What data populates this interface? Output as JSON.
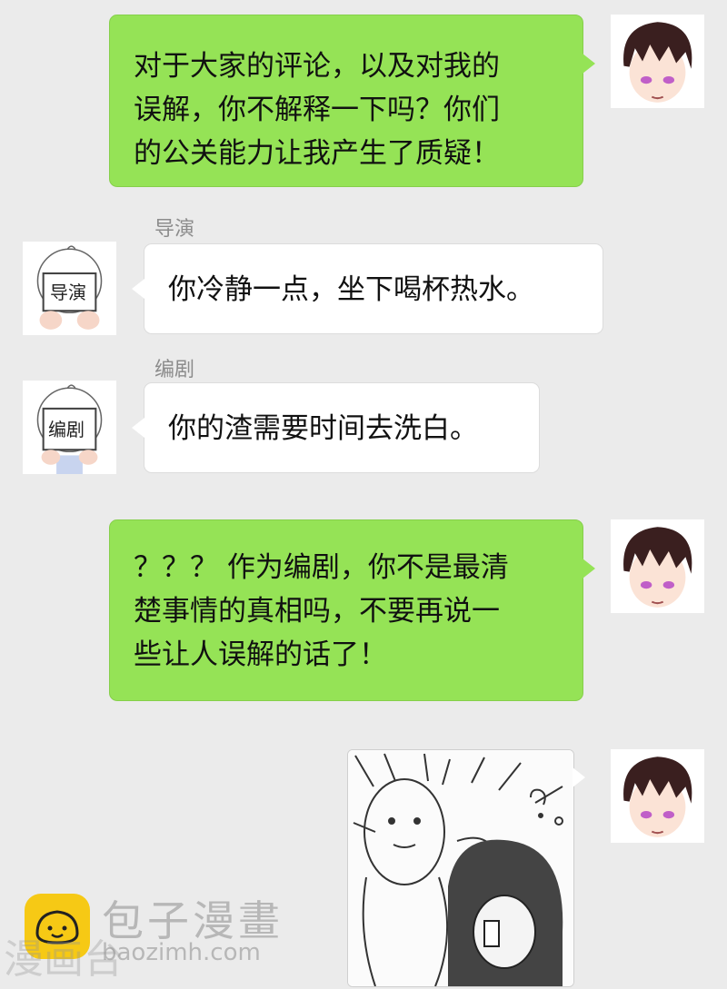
{
  "messages": [
    {
      "sender": "",
      "lines": [
        "对于大家的评论，以及对我的",
        "误解，你不解释一下吗？你们",
        "的公关能力让我产生了质疑！"
      ]
    },
    {
      "sender": "导演",
      "avatar_text": "导演",
      "lines": [
        "你冷静一点，坐下喝杯热水。"
      ]
    },
    {
      "sender": "编剧",
      "avatar_text": "编剧",
      "lines": [
        "你的渣需要时间去洗白。"
      ]
    },
    {
      "sender": "",
      "lines": [
        "？？？ 作为编剧，你不是最清",
        "楚事情的真相吗，不要再说一",
        "些让人误解的话了！"
      ]
    }
  ],
  "watermark": {
    "brand": "包子漫畫",
    "url": "baozimh.com",
    "side_text": "漫画台"
  },
  "colors": {
    "background": "#ebebeb",
    "green_bubble": "#95e356",
    "white_bubble": "#ffffff",
    "logo": "#f6c915"
  }
}
